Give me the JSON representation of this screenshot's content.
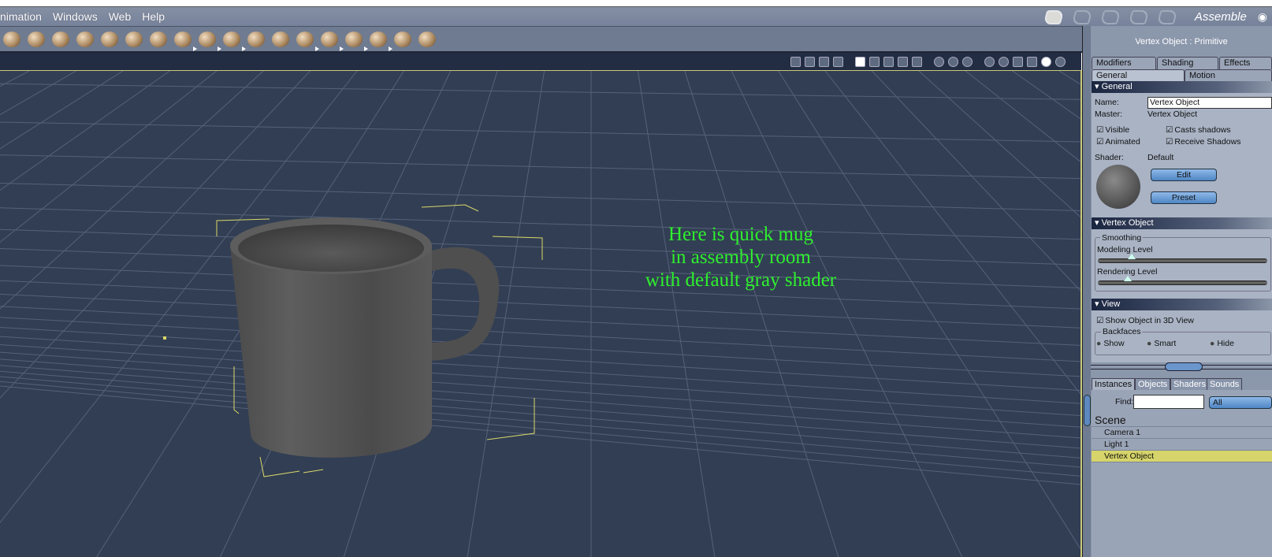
{
  "menubar": {
    "items": [
      "nimation",
      "Windows",
      "Web",
      "Help"
    ],
    "room_icons": [
      "pose-hand-icon",
      "face-room-icon",
      "material-room-icon",
      "hair-room-icon",
      "cloth-room-icon"
    ],
    "active_room": "Assemble"
  },
  "toolbar": {
    "tools": [
      {
        "icon": "sphere-primitive-icon",
        "submenu": false
      },
      {
        "icon": "bone-link-icon",
        "submenu": false
      },
      {
        "icon": "torus-icon",
        "submenu": false
      },
      {
        "icon": "text-icon",
        "submenu": false
      },
      {
        "icon": "particles-icon",
        "submenu": false
      },
      {
        "icon": "terrain-icon",
        "submenu": false
      },
      {
        "icon": "tree-icon",
        "submenu": false
      },
      {
        "icon": "cloud-icon",
        "submenu": true
      },
      {
        "icon": "fire-icon",
        "submenu": true
      },
      {
        "icon": "rocks-icon",
        "submenu": true
      },
      {
        "icon": "plant-icon",
        "submenu": false
      },
      {
        "icon": "bowl-icon",
        "submenu": false
      },
      {
        "icon": "metaball-icon",
        "submenu": true
      },
      {
        "icon": "light-icon",
        "submenu": true
      },
      {
        "icon": "camera-icon",
        "submenu": true
      },
      {
        "icon": "group-icon",
        "submenu": true
      },
      {
        "icon": "target-icon",
        "submenu": false
      },
      {
        "icon": "bone-icon",
        "submenu": false
      }
    ]
  },
  "viewport": {
    "annotation": [
      "Here is quick mug",
      "in assembly room",
      "with default gray shader"
    ],
    "accent": "#2ef02e"
  },
  "panel": {
    "title": "Vertex Object : Primitive",
    "tabs_top": [
      "Modifiers",
      "Shading",
      "Effects"
    ],
    "tabs_bottom": [
      "General",
      "Motion"
    ],
    "general": {
      "header": "General",
      "name_label": "Name:",
      "name_value": "Vertex Object",
      "master_label": "Master:",
      "master_value": "Vertex Object",
      "visible": "Visible",
      "casts_shadows": "Casts shadows",
      "animated": "Animated",
      "receive_shadows": "Receive Shadows",
      "shader_label": "Shader:",
      "shader_value": "Default",
      "edit": "Edit",
      "preset": "Preset"
    },
    "vertex": {
      "header": "Vertex Object",
      "smoothing": "Smoothing",
      "modeling_level": "Modeling Level",
      "rendering_level": "Rendering Level"
    },
    "view": {
      "header": "View",
      "show_object": "Show Object in 3D View",
      "backfaces": "Backfaces",
      "show": "Show",
      "smart": "Smart",
      "hide": "Hide"
    },
    "library": {
      "tabs": [
        "Instances",
        "Objects",
        "Shaders",
        "Sounds"
      ],
      "find_label": "Find:",
      "find_value": "",
      "filter": "All",
      "scene": "Scene",
      "items": [
        "Camera 1",
        "Light 1",
        "Vertex Object"
      ],
      "selected": "Vertex Object"
    }
  }
}
